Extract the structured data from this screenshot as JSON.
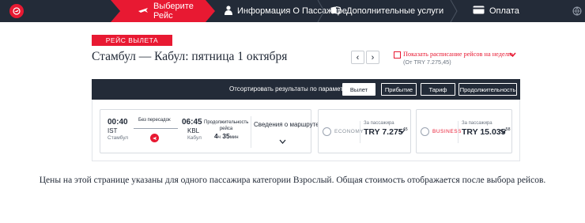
{
  "steps": [
    {
      "label": "Выберите Рейс",
      "icon": "plane-icon"
    },
    {
      "label": "Информация О Пассажире",
      "icon": "person-icon"
    },
    {
      "label": "Дополнительные услуги",
      "icon": "extras-icon"
    },
    {
      "label": "Оплата",
      "icon": "card-icon"
    }
  ],
  "header": {
    "departure_tag": "РЕЙС ВЫЛЕТА",
    "route_title": "Стамбул — Кабул: пятница 1 октября",
    "prev_arrow": "‹",
    "next_arrow": "›",
    "schedule_link": "Показать расписание рейсов на неделю",
    "schedule_sub": "(От TRY 7.275,45)"
  },
  "sortbar": {
    "label": "Отсортировать результаты по параметру",
    "buttons": [
      "Вылет",
      "Прибытие",
      "Тариф",
      "Продолжительность"
    ],
    "active": "Вылет"
  },
  "flight": {
    "dep_time": "00:40",
    "dep_code": "IST",
    "dep_city": "Стамбул",
    "stops": "Без пересадок",
    "arr_time": "06:45",
    "arr_code": "KBL",
    "arr_city": "Кабул",
    "duration_label": "Продолжительность рейса",
    "duration_h": "4",
    "duration_h_unit": "ч",
    "duration_m": "35",
    "duration_m_unit": "мин",
    "route_info": "Сведения о маршруте"
  },
  "fares": [
    {
      "name": "ECONOMY",
      "per": "За пассажира",
      "currency": "TRY",
      "price_main": "7.275",
      "price_dec": "45",
      "color": "#8a929c"
    },
    {
      "name": "BUSINESS",
      "per": "За пассажира",
      "currency": "TRY",
      "price_main": "15.035",
      "price_dec": "58",
      "color": "#e81932"
    }
  ],
  "footnote": "Цены на этой странице указаны для одного пассажира категории Взрослый. Общая стоимость отображается после выбора рейсов.",
  "colors": {
    "brand_red": "#e81932",
    "navy": "#232b38"
  }
}
